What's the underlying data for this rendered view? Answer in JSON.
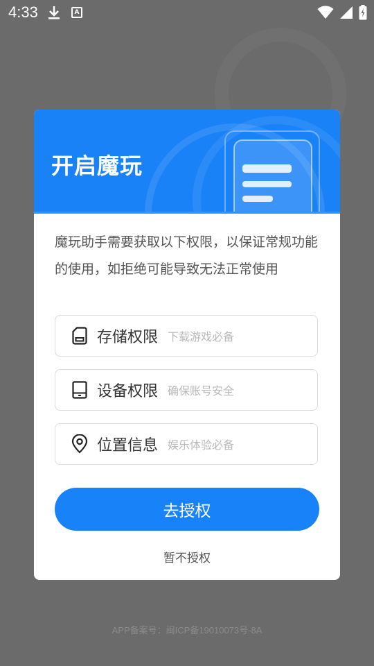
{
  "status_bar": {
    "time": "4:33",
    "icons": [
      "download-icon",
      "a-notification-icon",
      "wifi-icon",
      "signal-icon",
      "battery-icon"
    ],
    "a_glyph": "A"
  },
  "dialog": {
    "title": "开启魔玩",
    "description": "魔玩助手需要获取以下权限，以保证常规功能的使用，如拒绝可能导致无法正常使用",
    "permissions": [
      {
        "icon": "storage-icon",
        "title": "存储权限",
        "desc": "下载游戏必备"
      },
      {
        "icon": "device-icon",
        "title": "设备权限",
        "desc": "确保账号安全"
      },
      {
        "icon": "location-pin-icon",
        "title": "位置信息",
        "desc": "娱乐体验必备"
      }
    ],
    "primary_button": "去授权",
    "secondary_link": "暂不授权"
  },
  "footer": {
    "icp": "APP备案号：闽ICP备19010073号-8A"
  },
  "colors": {
    "accent": "#1883f8",
    "header_bg": "#1a82f7",
    "overlay": "#6b6b6b"
  }
}
